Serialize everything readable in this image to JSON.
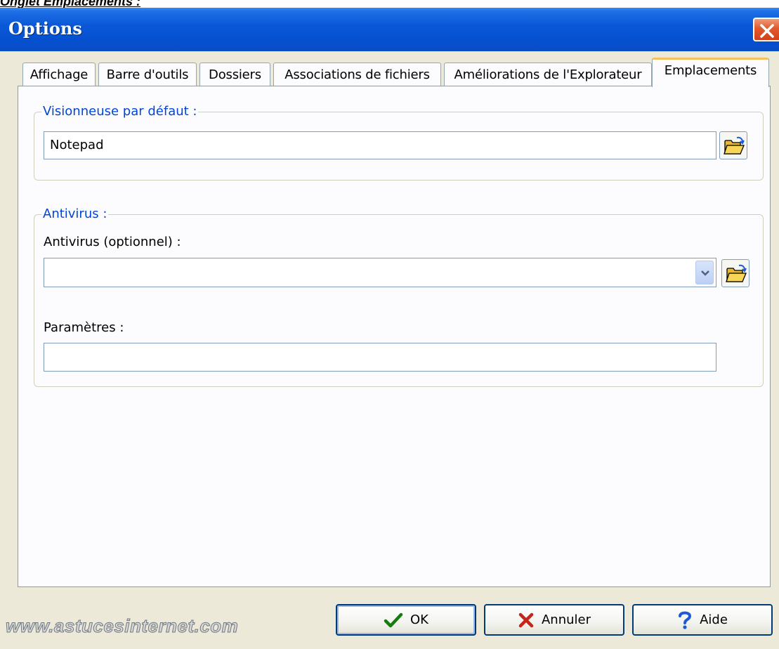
{
  "caption": "Onglet Emplacements :",
  "window": {
    "title": "Options"
  },
  "tabs": [
    {
      "label": "Affichage",
      "active": false
    },
    {
      "label": "Barre d'outils",
      "active": false
    },
    {
      "label": "Dossiers",
      "active": false
    },
    {
      "label": "Associations de fichiers",
      "active": false
    },
    {
      "label": "Améliorations de l'Explorateur",
      "active": false
    },
    {
      "label": "Emplacements",
      "active": true
    }
  ],
  "viewer_group": {
    "legend": "Visionneuse par défaut :",
    "value": "Notepad"
  },
  "antivirus_group": {
    "legend": "Antivirus :",
    "antivirus_label": "Antivirus (optionnel) :",
    "antivirus_value": "",
    "params_label": "Paramètres :",
    "params_value": ""
  },
  "buttons": {
    "ok": "OK",
    "cancel": "Annuler",
    "help": "Aide"
  },
  "watermark": "www.astucesinternet.com",
  "icons": {
    "close": "close-icon",
    "browse": "folder-open-icon",
    "dropdown": "chevron-down-icon",
    "ok": "checkmark-icon",
    "cancel": "x-icon",
    "help": "question-icon"
  }
}
